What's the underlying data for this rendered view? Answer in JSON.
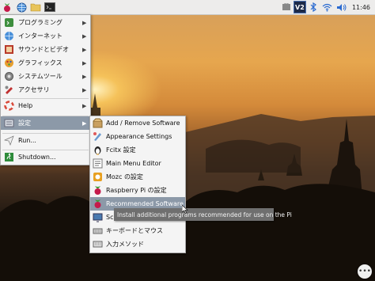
{
  "panel": {
    "clock": "11:46",
    "vnc_label": "V2"
  },
  "menu": {
    "items": [
      {
        "label": "プログラミング",
        "icon": "programming-icon"
      },
      {
        "label": "インターネット",
        "icon": "internet-globe-icon"
      },
      {
        "label": "サウンドとビデオ",
        "icon": "sound-video-icon"
      },
      {
        "label": "グラフィックス",
        "icon": "graphics-icon"
      },
      {
        "label": "システムツール",
        "icon": "system-tools-icon"
      },
      {
        "label": "アクセサリ",
        "icon": "accessories-icon"
      },
      {
        "label": "Help",
        "icon": "help-lifebuoy-icon"
      },
      {
        "label": "設定",
        "icon": "preferences-icon"
      },
      {
        "label": "Run...",
        "icon": "run-paper-plane-icon"
      },
      {
        "label": "Shutdown...",
        "icon": "shutdown-exit-icon"
      }
    ]
  },
  "submenu": {
    "items": [
      {
        "label": "Add / Remove Software",
        "icon": "package-icon"
      },
      {
        "label": "Appearance Settings",
        "icon": "appearance-icon"
      },
      {
        "label": "Fcitx 設定",
        "icon": "fcitx-penguin-icon"
      },
      {
        "label": "Main Menu Editor",
        "icon": "menu-editor-icon"
      },
      {
        "label": "Mozc の設定",
        "icon": "mozc-icon"
      },
      {
        "label": "Raspberry Pi の設定",
        "icon": "raspberry-icon"
      },
      {
        "label": "Recommended Software",
        "icon": "raspberry-icon"
      },
      {
        "label": "Sc",
        "icon": "screen-config-icon"
      },
      {
        "label": "キーボードとマウス",
        "icon": "keyboard-mouse-icon"
      },
      {
        "label": "入力メソッド",
        "icon": "input-method-icon"
      }
    ]
  },
  "tooltip": "Install additional programs recommended for use on the Pi"
}
